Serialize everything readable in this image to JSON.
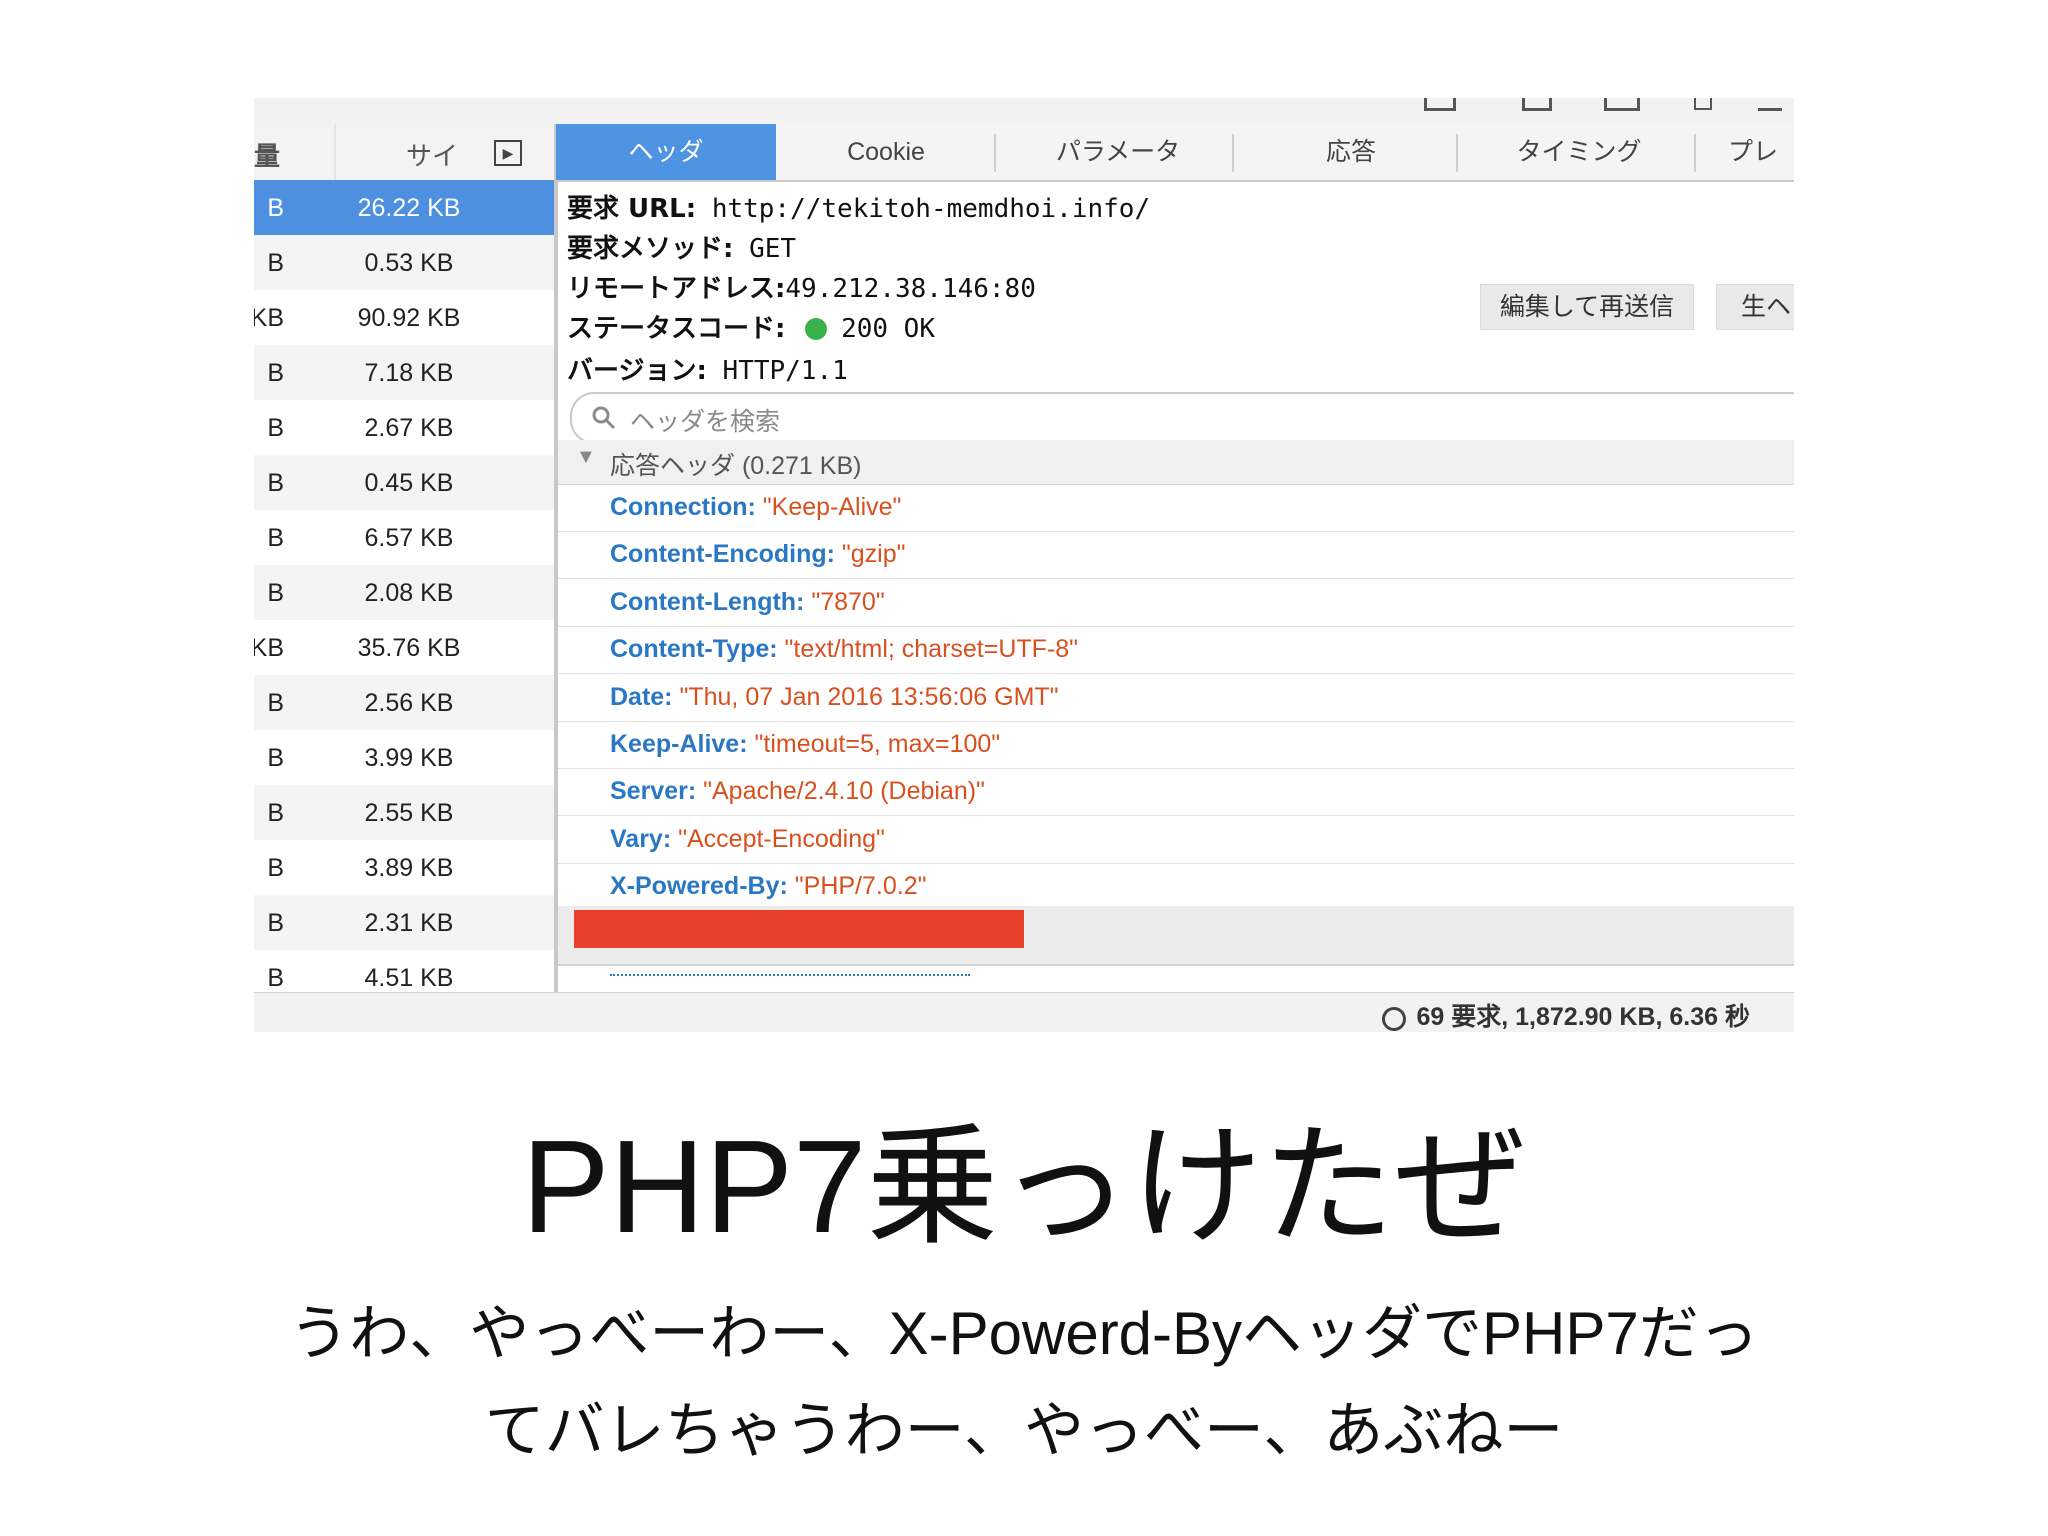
{
  "devtools": {
    "left_header_label": "サイ",
    "left_rows": [
      {
        "cut": "B",
        "size": "26.22 KB"
      },
      {
        "cut": "B",
        "size": "0.53 KB"
      },
      {
        "cut": "KB",
        "size": "90.92 KB"
      },
      {
        "cut": "B",
        "size": "7.18 KB"
      },
      {
        "cut": "B",
        "size": "2.67 KB"
      },
      {
        "cut": "B",
        "size": "0.45 KB"
      },
      {
        "cut": "B",
        "size": "6.57 KB"
      },
      {
        "cut": "B",
        "size": "2.08 KB"
      },
      {
        "cut": "KB",
        "size": "35.76 KB"
      },
      {
        "cut": "B",
        "size": "2.56 KB"
      },
      {
        "cut": "B",
        "size": "3.99 KB"
      },
      {
        "cut": "B",
        "size": "2.55 KB"
      },
      {
        "cut": "B",
        "size": "3.89 KB"
      },
      {
        "cut": "B",
        "size": "2.31 KB"
      },
      {
        "cut": "B",
        "size": "4.51 KB"
      }
    ],
    "tabs": [
      "ヘッダ",
      "Cookie",
      "パラメータ",
      "応答",
      "タイミング",
      "プレ"
    ],
    "summary": {
      "url_label": "要求 URL:",
      "url": "http://tekitoh-memdhoi.info/",
      "method_label": "要求メソッド:",
      "method": "GET",
      "remote_label": "リモートアドレス:",
      "remote": "49.212.38.146:80",
      "status_label": "ステータスコード:",
      "status": "200 OK",
      "status_color": "#38b34a",
      "version_label": "バージョン:",
      "version": "HTTP/1.1"
    },
    "buttons": {
      "resend": "編集して再送信",
      "raw": "生ヘ"
    },
    "search_placeholder": "ヘッダを検索",
    "response_section": "応答ヘッダ (0.271 KB)",
    "headers": [
      {
        "name": "Connection:",
        "value": "\"Keep-Alive\""
      },
      {
        "name": "Content-Encoding:",
        "value": "\"gzip\""
      },
      {
        "name": "Content-Length:",
        "value": "\"7870\""
      },
      {
        "name": "Content-Type:",
        "value": "\"text/html; charset=UTF-8\""
      },
      {
        "name": "Date:",
        "value": "\"Thu, 07 Jan 2016 13:56:06 GMT\""
      },
      {
        "name": "Keep-Alive:",
        "value": "\"timeout=5, max=100\""
      },
      {
        "name": "Server:",
        "value": "\"Apache/2.4.10 (Debian)\""
      },
      {
        "name": "Vary:",
        "value": "\"Accept-Encoding\""
      },
      {
        "name": "X-Powered-By:",
        "value": "\"PHP/7.0.2\""
      }
    ],
    "status_bar": "69 要求, 1,872.90 KB, 6.36 秒",
    "accent": "#4f93e3",
    "header_name_color": "#2a77c4",
    "header_value_color": "#d8501e",
    "redaction_color": "#e8402a"
  },
  "slide": {
    "title": "PHP7乗っけたぜ",
    "subtitle_line1": "うわ、やっべーわー、X-Powerd-ByヘッダでPHP7だっ",
    "subtitle_line2": "てバレちゃうわー、やっべー、あぶねー"
  }
}
